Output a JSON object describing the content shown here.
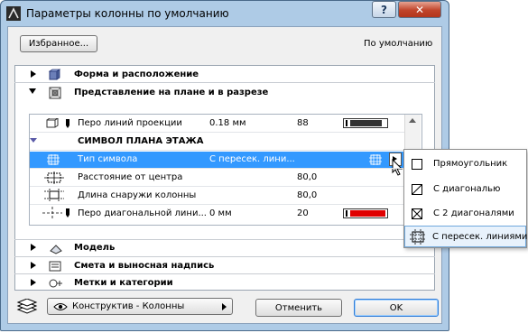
{
  "window": {
    "title": "Параметры колонны по умолчанию",
    "help_label": "?",
    "close_label": "✕"
  },
  "header": {
    "favorites_button": "Избранное...",
    "default_label": "По умолчанию"
  },
  "sections": {
    "form": "Форма и расположение",
    "plan": "Представление на плане и в разрезе",
    "model": "Модель",
    "estimate": "Смета и выносная надпись",
    "tags": "Метки и категории"
  },
  "table": {
    "rows": [
      {
        "name": "Перо линий проекции",
        "value": "0.18 мм",
        "number": "88",
        "pen_color": "#333333"
      },
      {
        "name": "СИМВОЛ ПЛАНА ЭТАЖА",
        "value": "",
        "number": "",
        "pen_color": ""
      },
      {
        "name": "Тип символа",
        "value": "С пересек. лини...",
        "number": "",
        "pen_color": ""
      },
      {
        "name": "Расстояние от центра",
        "value": "",
        "number": "80,0",
        "pen_color": ""
      },
      {
        "name": "Длина снаружи колонны",
        "value": "",
        "number": "80,0",
        "pen_color": ""
      },
      {
        "name": "Перо диагональной лини...",
        "value": "0 мм",
        "number": "20",
        "pen_color": "#e00000"
      }
    ]
  },
  "dropdown": {
    "options": [
      {
        "label": "Прямоугольник",
        "icon": "rectangle-icon"
      },
      {
        "label": "С диагональю",
        "icon": "single-diagonal-icon"
      },
      {
        "label": "С 2 диагоналями",
        "icon": "double-diagonal-icon"
      },
      {
        "label": "С пересек. линиями",
        "icon": "crossing-lines-icon"
      }
    ],
    "selected_index": 3
  },
  "footer": {
    "layer_button": "Конструктив - Колонны",
    "cancel_button": "Отменить",
    "ok_button": "OK"
  },
  "colors": {
    "selection": "#3399ff",
    "title_bar": "#aecbe6",
    "close_button": "#c0442a"
  }
}
